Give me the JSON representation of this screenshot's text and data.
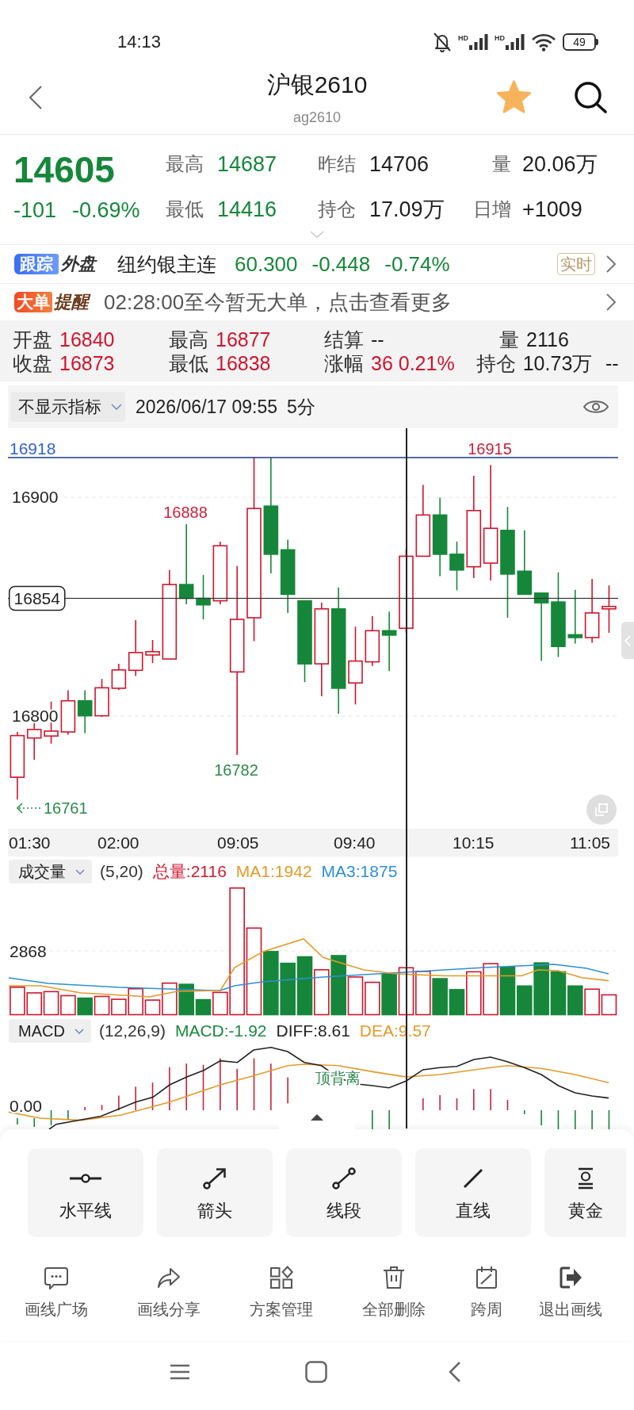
{
  "status_bar": {
    "time": "14:13",
    "networks": [
      {
        "label": "HD"
      },
      {
        "label": "HD"
      }
    ],
    "battery": "49"
  },
  "header": {
    "title": "沪银2610",
    "code": "ag2610",
    "favorite": true
  },
  "quote": {
    "price": "14605",
    "change": "-101",
    "change_pct": "-0.69%",
    "down": true,
    "stats": [
      {
        "label": "最高",
        "value": "14687",
        "color": "#16873a"
      },
      {
        "label": "昨结",
        "value": "14706",
        "color": "#1f1f1f"
      },
      {
        "label": "量",
        "value": "20.06万",
        "color": "#1f1f1f"
      },
      {
        "label": "最低",
        "value": "14416",
        "color": "#16873a"
      },
      {
        "label": "持仓",
        "value": "17.09万",
        "color": "#1f1f1f"
      },
      {
        "label": "日增",
        "value": "+1009",
        "color": "#1f1f1f"
      }
    ]
  },
  "overseas": {
    "tag": "跟踪",
    "tag_suffix": "外盘",
    "name": "纽约银主连",
    "price": "60.300",
    "change": "-0.448",
    "change_pct": "-0.74%",
    "down": true,
    "mode": "实时"
  },
  "big_order": {
    "tag": "大单",
    "tag_suffix": "提醒",
    "text": "02:28:00至今暂无大单，点击查看更多"
  },
  "bar_info": {
    "rows": [
      [
        {
          "label": "开盘",
          "value": "16840",
          "color": "#d0142c"
        },
        {
          "label": "最高",
          "value": "16877",
          "color": "#d0142c"
        },
        {
          "label": "结算",
          "value": "--",
          "color": "#1f1f1f"
        },
        {
          "label": "量",
          "value": "2116",
          "color": "#1f1f1f"
        }
      ],
      [
        {
          "label": "收盘",
          "value": "16873",
          "color": "#d0142c"
        },
        {
          "label": "最低",
          "value": "16838",
          "color": "#d0142c"
        },
        {
          "label": "涨幅",
          "value": "36 0.21%",
          "color": "#d0142c"
        },
        {
          "label": "持仓",
          "value": "10.73万",
          "color": "#1f1f1f"
        },
        {
          "value": "--",
          "color": "#1f1f1f"
        }
      ]
    ]
  },
  "chart": {
    "indicator": "不显示指标",
    "datetime": "2026/06/17 09:55",
    "period": "5分",
    "price_labels": [
      {
        "text": "16918",
        "kind": "drawn_line"
      },
      {
        "text": "16900",
        "kind": "axis"
      },
      {
        "text": "16854",
        "kind": "cursor"
      },
      {
        "text": "16800",
        "kind": "axis"
      }
    ],
    "extremes": [
      {
        "text": "16888",
        "kind": "high"
      },
      {
        "text": "16915",
        "kind": "high"
      },
      {
        "text": "16782",
        "kind": "low"
      },
      {
        "text": "16761",
        "kind": "lowest"
      }
    ],
    "times": [
      "01:30",
      "02:00",
      "09:05",
      "09:40",
      "10:15",
      "11:05"
    ]
  },
  "volume": {
    "indicator": "成交量",
    "params": "(5,20)",
    "stats": [
      {
        "text": "总量:2116",
        "color": "#cf1b2e"
      },
      {
        "text": "MA1:1942",
        "color": "#e39a2a"
      },
      {
        "text": "MA3:1875",
        "color": "#2e8fd6"
      }
    ],
    "axis_label": "2868"
  },
  "macd": {
    "indicator": "MACD",
    "params": "(12,26,9)",
    "stats": [
      {
        "text": "MACD:-1.92",
        "color": "#1a8a3e"
      },
      {
        "text": "DIFF:8.61",
        "color": "#222222"
      },
      {
        "text": "DEA:9.57",
        "color": "#e39a2a"
      }
    ],
    "axis_label": "0.00",
    "annotation": "顶背离"
  },
  "tools": [
    {
      "label": "水平线",
      "kind": "horizontal"
    },
    {
      "label": "箭头",
      "kind": "arrow"
    },
    {
      "label": "线段",
      "kind": "segment"
    },
    {
      "label": "直线",
      "kind": "line"
    },
    {
      "label": "黄金",
      "kind": "fibonacci"
    }
  ],
  "actions": [
    {
      "label": "画线广场",
      "kind": "square"
    },
    {
      "label": "画线分享",
      "kind": "share"
    },
    {
      "label": "方案管理",
      "kind": "plans"
    },
    {
      "label": "全部删除",
      "kind": "delete"
    },
    {
      "label": "跨周",
      "kind": "cross_period"
    }
  ],
  "exit": {
    "label": "退出画线"
  }
}
